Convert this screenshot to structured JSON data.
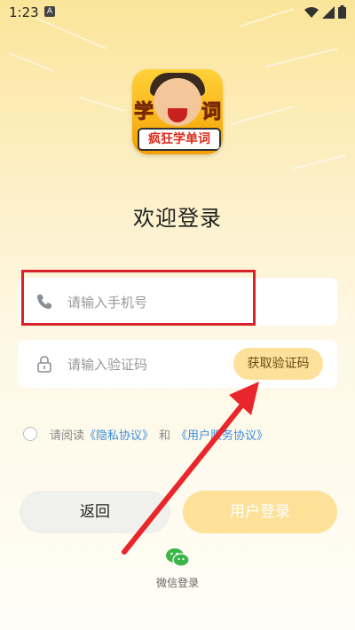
{
  "status_bar": {
    "time": "1:23",
    "notification_badge": "A"
  },
  "logo": {
    "side_left": "学",
    "side_right": "词",
    "banner": "疯狂学单词"
  },
  "page_title": "欢迎登录",
  "phone_field": {
    "placeholder": "请输入手机号",
    "icon": "phone-icon"
  },
  "code_field": {
    "placeholder": "请输入验证码",
    "icon": "lock-icon",
    "get_code_label": "获取验证码"
  },
  "agreement": {
    "prefix": "请阅读",
    "privacy_link": "《隐私协议》",
    "and": "和",
    "service_link": "《用户服务协议》"
  },
  "buttons": {
    "back_label": "返回",
    "login_label": "用户登录"
  },
  "wechat": {
    "label": "微信登录",
    "icon": "wechat-icon"
  },
  "colors": {
    "accent": "#fde199",
    "link": "#3a8de0",
    "highlight": "#d8232a",
    "annotation_arrow": "#e8262b"
  }
}
